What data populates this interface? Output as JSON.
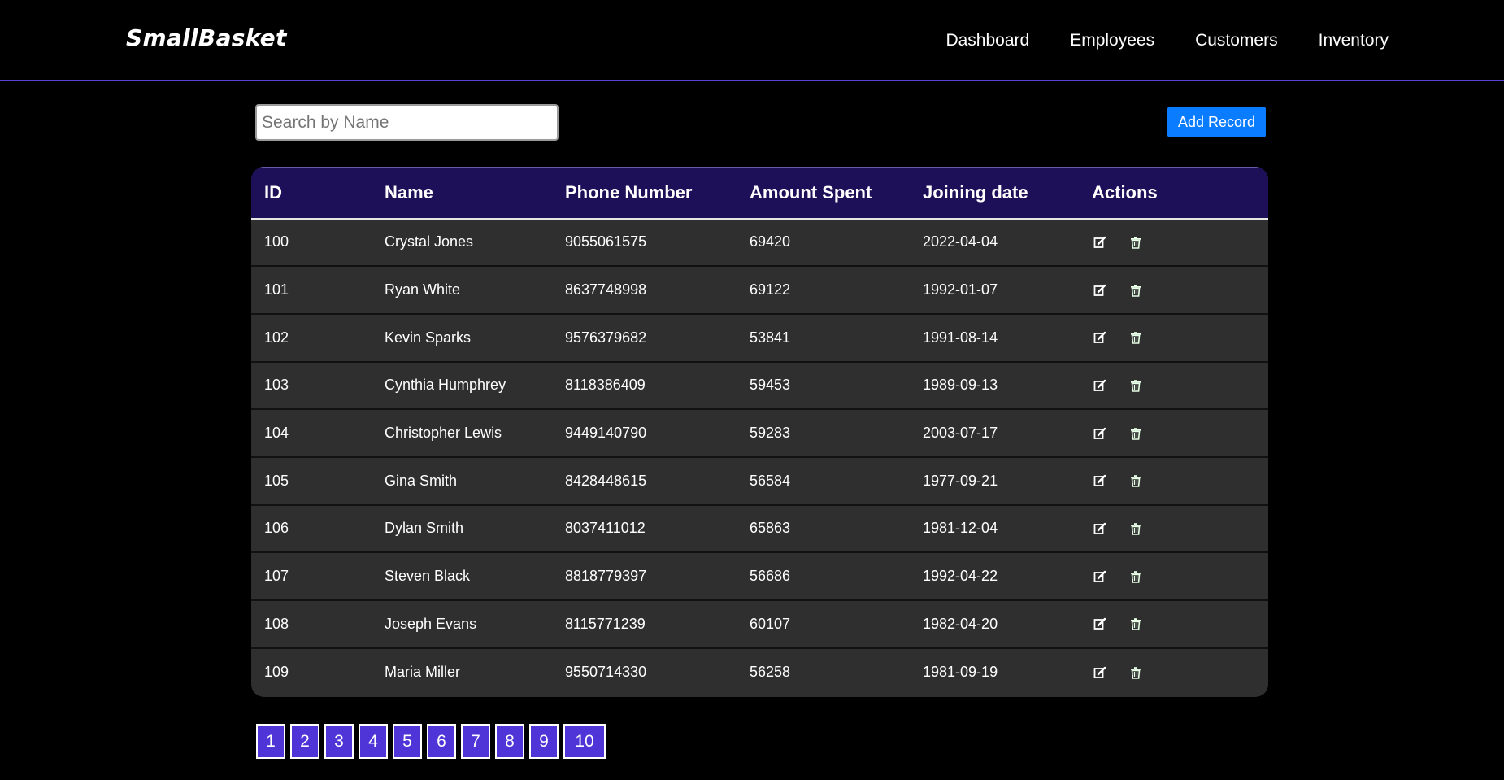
{
  "brand": "SmallBasket",
  "nav": [
    "Dashboard",
    "Employees",
    "Customers",
    "Inventory"
  ],
  "search": {
    "placeholder": "Search by Name",
    "value": ""
  },
  "add_button_label": "Add Record",
  "table": {
    "headers": [
      "ID",
      "Name",
      "Phone Number",
      "Amount Spent",
      "Joining date",
      "Actions"
    ],
    "rows": [
      {
        "id": "100",
        "name": "Crystal Jones",
        "phone": "9055061575",
        "amount": "69420",
        "date": "2022-04-04"
      },
      {
        "id": "101",
        "name": "Ryan White",
        "phone": "8637748998",
        "amount": "69122",
        "date": "1992-01-07"
      },
      {
        "id": "102",
        "name": "Kevin Sparks",
        "phone": "9576379682",
        "amount": "53841",
        "date": "1991-08-14"
      },
      {
        "id": "103",
        "name": "Cynthia Humphrey",
        "phone": "8118386409",
        "amount": "59453",
        "date": "1989-09-13"
      },
      {
        "id": "104",
        "name": "Christopher Lewis",
        "phone": "9449140790",
        "amount": "59283",
        "date": "2003-07-17"
      },
      {
        "id": "105",
        "name": "Gina Smith",
        "phone": "8428448615",
        "amount": "56584",
        "date": "1977-09-21"
      },
      {
        "id": "106",
        "name": "Dylan Smith",
        "phone": "8037411012",
        "amount": "65863",
        "date": "1981-12-04"
      },
      {
        "id": "107",
        "name": "Steven Black",
        "phone": "8818779397",
        "amount": "56686",
        "date": "1992-04-22"
      },
      {
        "id": "108",
        "name": "Joseph Evans",
        "phone": "8115771239",
        "amount": "60107",
        "date": "1982-04-20"
      },
      {
        "id": "109",
        "name": "Maria Miller",
        "phone": "9550714330",
        "amount": "56258",
        "date": "1981-09-19"
      }
    ],
    "row_icons": [
      "edit-icon",
      "trash-icon"
    ]
  },
  "pagination": [
    "1",
    "2",
    "3",
    "4",
    "5",
    "6",
    "7",
    "8",
    "9",
    "10"
  ],
  "colors": {
    "background": "#000000",
    "nav_border": "#5a3fd9",
    "table_header": "#1e1058",
    "table_row": "#2f2f2f",
    "add_button": "#0a7cff",
    "page_button": "#4f34d8"
  }
}
